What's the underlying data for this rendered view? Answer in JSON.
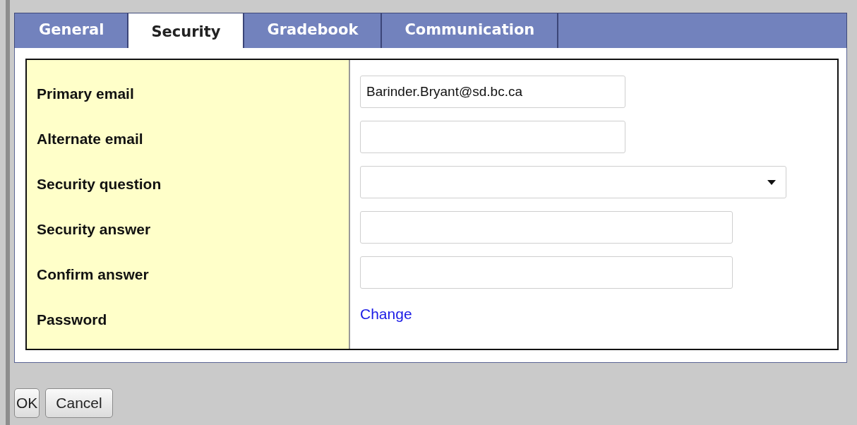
{
  "tabs": [
    {
      "label": "General",
      "selected": false
    },
    {
      "label": "Security",
      "selected": true
    },
    {
      "label": "Gradebook",
      "selected": false
    },
    {
      "label": "Communication",
      "selected": false
    }
  ],
  "form": [
    {
      "label": "Primary email",
      "kind": "email",
      "value": "Barinder.Bryant@sd.bc.ca"
    },
    {
      "label": "Alternate email",
      "kind": "email"
    },
    {
      "label": "Security question",
      "kind": "select"
    },
    {
      "label": "Security answer",
      "kind": "answer"
    },
    {
      "label": "Confirm answer",
      "kind": "answer"
    },
    {
      "label": "Password",
      "kind": "link",
      "link": "Change"
    }
  ],
  "buttons": [
    "OK",
    "Cancel"
  ]
}
